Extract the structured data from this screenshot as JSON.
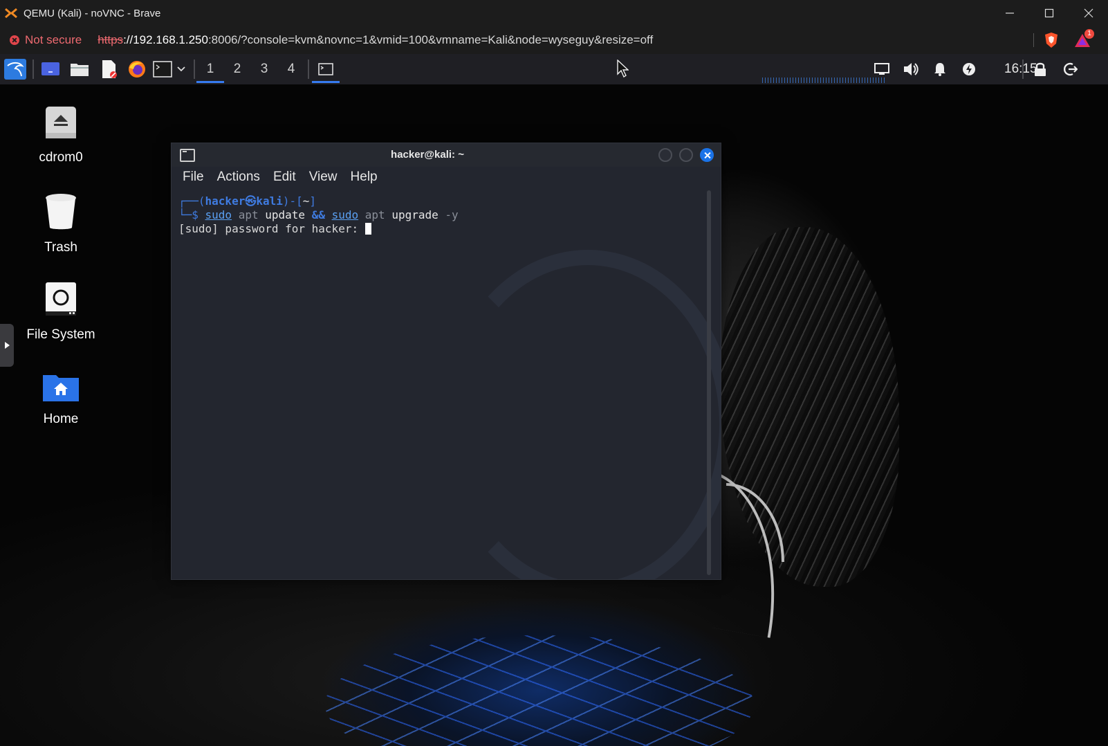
{
  "browser": {
    "window_title": "QEMU (Kali) - noVNC - Brave",
    "security_label": "Not secure",
    "url_scheme": "https",
    "url_host": "://192.168.1.250",
    "url_rest": ":8006/?console=kvm&novnc=1&vmid=100&vmname=Kali&node=wyseguy&resize=off",
    "rewards_badge": "1"
  },
  "panel": {
    "workspaces": [
      "1",
      "2",
      "3",
      "4"
    ],
    "active_workspace": "1",
    "clock": "16:15",
    "accent_color": "#367bf0"
  },
  "desktop": {
    "icons": [
      {
        "label": "cdrom0"
      },
      {
        "label": "Trash"
      },
      {
        "label": "File System"
      },
      {
        "label": "Home"
      }
    ]
  },
  "terminal": {
    "title": "hacker@kali: ~",
    "menu": [
      "File",
      "Actions",
      "Edit",
      "View",
      "Help"
    ],
    "prompt_open": "┌──(",
    "prompt_user": "hacker",
    "prompt_at": "㉿",
    "prompt_host": "kali",
    "prompt_close": ")-[",
    "prompt_dir": "~",
    "prompt_end": "]",
    "prompt2": "└─$ ",
    "cmd": {
      "t1": "sudo",
      "t2": "apt",
      "t3": "update",
      "t4": "&&",
      "t5": "sudo",
      "t6": "apt",
      "t7": "upgrade",
      "t8": "-y"
    },
    "output_line": "[sudo] password for hacker: "
  }
}
